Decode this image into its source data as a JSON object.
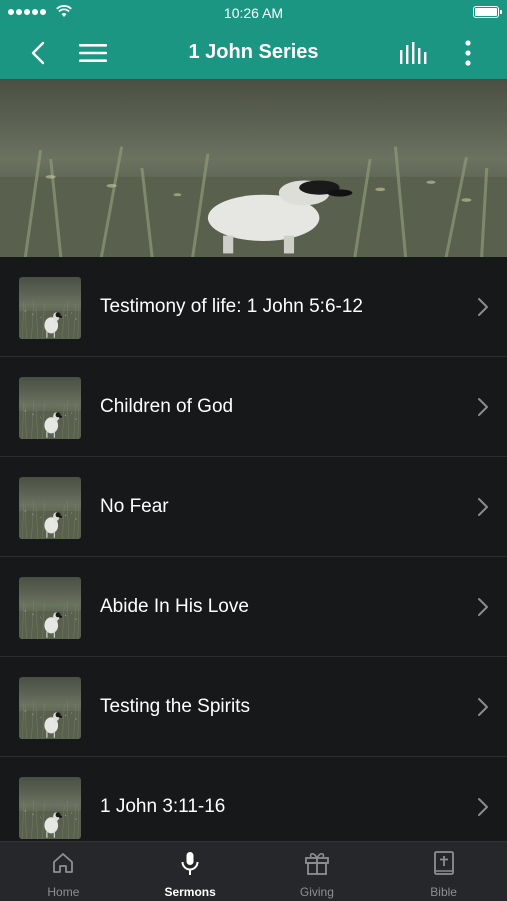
{
  "status_bar": {
    "time": "10:26 AM"
  },
  "nav": {
    "title": "1 John Series",
    "icons": [
      "back-icon",
      "menu-icon",
      "audio-bars-icon",
      "more-icon"
    ]
  },
  "sermons": [
    {
      "title": "Testimony of life: 1 John 5:6-12"
    },
    {
      "title": "Children of God"
    },
    {
      "title": "No Fear"
    },
    {
      "title": "Abide In His Love"
    },
    {
      "title": "Testing the Spirits"
    },
    {
      "title": "1 John 3:11-16"
    }
  ],
  "tabs": [
    {
      "label": "Home",
      "icon": "home-icon",
      "active": false
    },
    {
      "label": "Sermons",
      "icon": "microphone-icon",
      "active": true
    },
    {
      "label": "Giving",
      "icon": "gift-icon",
      "active": false
    },
    {
      "label": "Bible",
      "icon": "bible-icon",
      "active": false
    }
  ],
  "colors": {
    "accent": "#1a9683",
    "background": "#17181a",
    "tab_bar": "#26272a"
  }
}
